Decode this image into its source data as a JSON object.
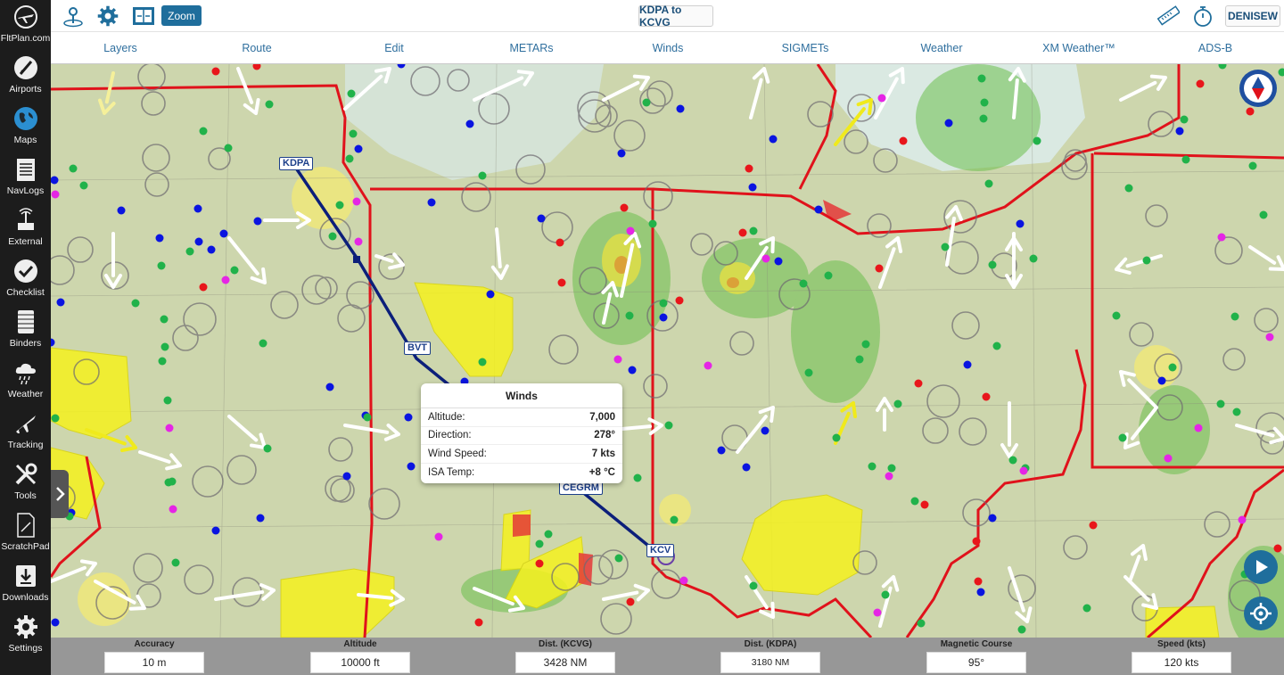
{
  "app": {
    "logo_label": "FltPlan.com"
  },
  "sidebar": {
    "items": [
      {
        "label": "FltPlan.com",
        "icon": "plane-globe-icon"
      },
      {
        "label": "Airports",
        "icon": "airport-icon"
      },
      {
        "label": "Maps",
        "icon": "globe-icon"
      },
      {
        "label": "NavLogs",
        "icon": "navlog-icon"
      },
      {
        "label": "External",
        "icon": "external-antenna-icon"
      },
      {
        "label": "Checklist",
        "icon": "checkmark-icon"
      },
      {
        "label": "Binders",
        "icon": "binder-icon"
      },
      {
        "label": "Weather",
        "icon": "cloud-rain-icon"
      },
      {
        "label": "Tracking",
        "icon": "plane-tracking-icon"
      },
      {
        "label": "Tools",
        "icon": "tools-icon"
      },
      {
        "label": "ScratchPad",
        "icon": "scratchpad-icon"
      },
      {
        "label": "Downloads",
        "icon": "download-icon"
      },
      {
        "label": "Settings",
        "icon": "gear-icon"
      }
    ]
  },
  "toolbar": {
    "zoom_label": "Zoom",
    "route_title": "KDPA to KCVG",
    "user_label": "DENISEW"
  },
  "tabs": [
    "Layers",
    "Route",
    "Edit",
    "METARs",
    "Winds",
    "SIGMETs",
    "Weather",
    "XM Weather™",
    "ADS-B"
  ],
  "map": {
    "waypoints": [
      "KDPA",
      "BVT",
      "CEGRM",
      "KCVG"
    ],
    "waypoint_display": [
      "KDPA",
      "BVT",
      "CEGRM",
      "KCV"
    ]
  },
  "winds_popup": {
    "title": "Winds",
    "rows": [
      {
        "label": "Altitude:",
        "value": "7,000"
      },
      {
        "label": "Direction:",
        "value": "278°"
      },
      {
        "label": "Wind Speed:",
        "value": "7 kts"
      },
      {
        "label": "ISA Temp:",
        "value": "+8 °C"
      }
    ]
  },
  "status": [
    {
      "label": "Accuracy",
      "value": "10 m"
    },
    {
      "label": "Altitude",
      "value": "10000 ft"
    },
    {
      "label": "Dist. (KCVG)",
      "value": "3428 NM"
    },
    {
      "label": "Dist. (KDPA)",
      "value": "3180 NM"
    },
    {
      "label": "Magnetic Course",
      "value": "95°"
    },
    {
      "label": "Speed (kts)",
      "value": "120 kts"
    }
  ],
  "colors": {
    "accent": "#1f6e9c",
    "tab_text": "#2f6f9e",
    "route_line": "#0c1f7a",
    "airspace_border": "#e0121b",
    "sigmet_fill": "#f5f21e"
  }
}
